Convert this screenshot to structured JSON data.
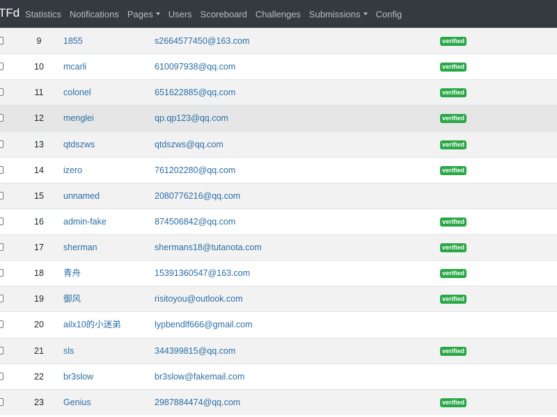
{
  "navbar": {
    "brand": "TFd",
    "items": [
      {
        "label": "Statistics",
        "dropdown": false
      },
      {
        "label": "Notifications",
        "dropdown": false
      },
      {
        "label": "Pages",
        "dropdown": true
      },
      {
        "label": "Users",
        "dropdown": false
      },
      {
        "label": "Scoreboard",
        "dropdown": false
      },
      {
        "label": "Challenges",
        "dropdown": false
      },
      {
        "label": "Submissions",
        "dropdown": true
      },
      {
        "label": "Config",
        "dropdown": false
      }
    ]
  },
  "colors": {
    "navbar_bg": "#343a40",
    "link": "#2a6fa8",
    "verified_badge": "#28a745"
  },
  "users": [
    {
      "id": "9",
      "name": "1855",
      "email": "s2664577450@163.com",
      "verified": "verified"
    },
    {
      "id": "10",
      "name": "mcarli",
      "email": "610097938@qq.com",
      "verified": "verified"
    },
    {
      "id": "11",
      "name": "colonel",
      "email": "651622885@qq.com",
      "verified": "verified"
    },
    {
      "id": "12",
      "name": "menglei",
      "email": "qp.qp123@qq.com",
      "verified": "verified"
    },
    {
      "id": "13",
      "name": "qtdszws",
      "email": "qtdszws@qq.com",
      "verified": "verified"
    },
    {
      "id": "14",
      "name": "izero",
      "email": "761202280@qq.com",
      "verified": "verified"
    },
    {
      "id": "15",
      "name": "unnamed",
      "email": "2080776216@qq.com",
      "verified": ""
    },
    {
      "id": "16",
      "name": "admin-fake",
      "email": "874506842@qq.com",
      "verified": "verified"
    },
    {
      "id": "17",
      "name": "sherman",
      "email": "shermans18@tutanota.com",
      "verified": "verified"
    },
    {
      "id": "18",
      "name": "青舟",
      "email": "15391360547@163.com",
      "verified": "verified"
    },
    {
      "id": "19",
      "name": "御风",
      "email": "risitoyou@outlook.com",
      "verified": "verified"
    },
    {
      "id": "20",
      "name": "ailx10的小迷弟",
      "email": "lypbendlf666@gmail.com",
      "verified": ""
    },
    {
      "id": "21",
      "name": "sls",
      "email": "344399815@qq.com",
      "verified": "verified"
    },
    {
      "id": "22",
      "name": "br3slow",
      "email": "br3slow@fakemail.com",
      "verified": ""
    },
    {
      "id": "23",
      "name": "Genius",
      "email": "2987884474@qq.com",
      "verified": "verified"
    }
  ]
}
